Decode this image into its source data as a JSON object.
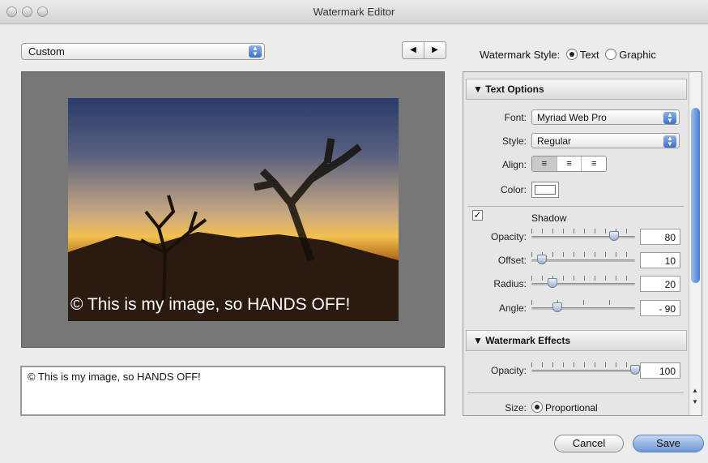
{
  "window": {
    "title": "Watermark Editor"
  },
  "preset": {
    "value": "Custom"
  },
  "nav": {
    "prev": "◀",
    "next": "▶"
  },
  "preview": {
    "caption": "© This is my image, so HANDS OFF!"
  },
  "text_input": {
    "value": "© This is my image, so HANDS OFF!"
  },
  "watermark_style": {
    "label": "Watermark Style:",
    "options": [
      "Text",
      "Graphic"
    ],
    "selected": "Text"
  },
  "text_options": {
    "header": "Text Options",
    "font_label": "Font:",
    "font_value": "Myriad Web Pro",
    "style_label": "Style:",
    "style_value": "Regular",
    "align_label": "Align:",
    "align_buttons": [
      "≡",
      "≡",
      "≡"
    ],
    "color_label": "Color:",
    "shadow": {
      "label": "Shadow",
      "checked": true,
      "opacity_label": "Opacity:",
      "opacity_value": "80",
      "opacity_level": 0.8,
      "offset_label": "Offset:",
      "offset_value": "10",
      "offset_level": 0.1,
      "radius_label": "Radius:",
      "radius_value": "20",
      "radius_level": 0.2,
      "angle_label": "Angle:",
      "angle_value": "- 90",
      "angle_level": 0.25
    }
  },
  "watermark_effects": {
    "header": "Watermark Effects",
    "opacity_label": "Opacity:",
    "opacity_value": "100",
    "opacity_level": 1.0,
    "size_label": "Size:",
    "size_option": "Proportional"
  },
  "buttons": {
    "cancel": "Cancel",
    "save": "Save"
  },
  "colors": {
    "accent": "#4a7bcf"
  }
}
